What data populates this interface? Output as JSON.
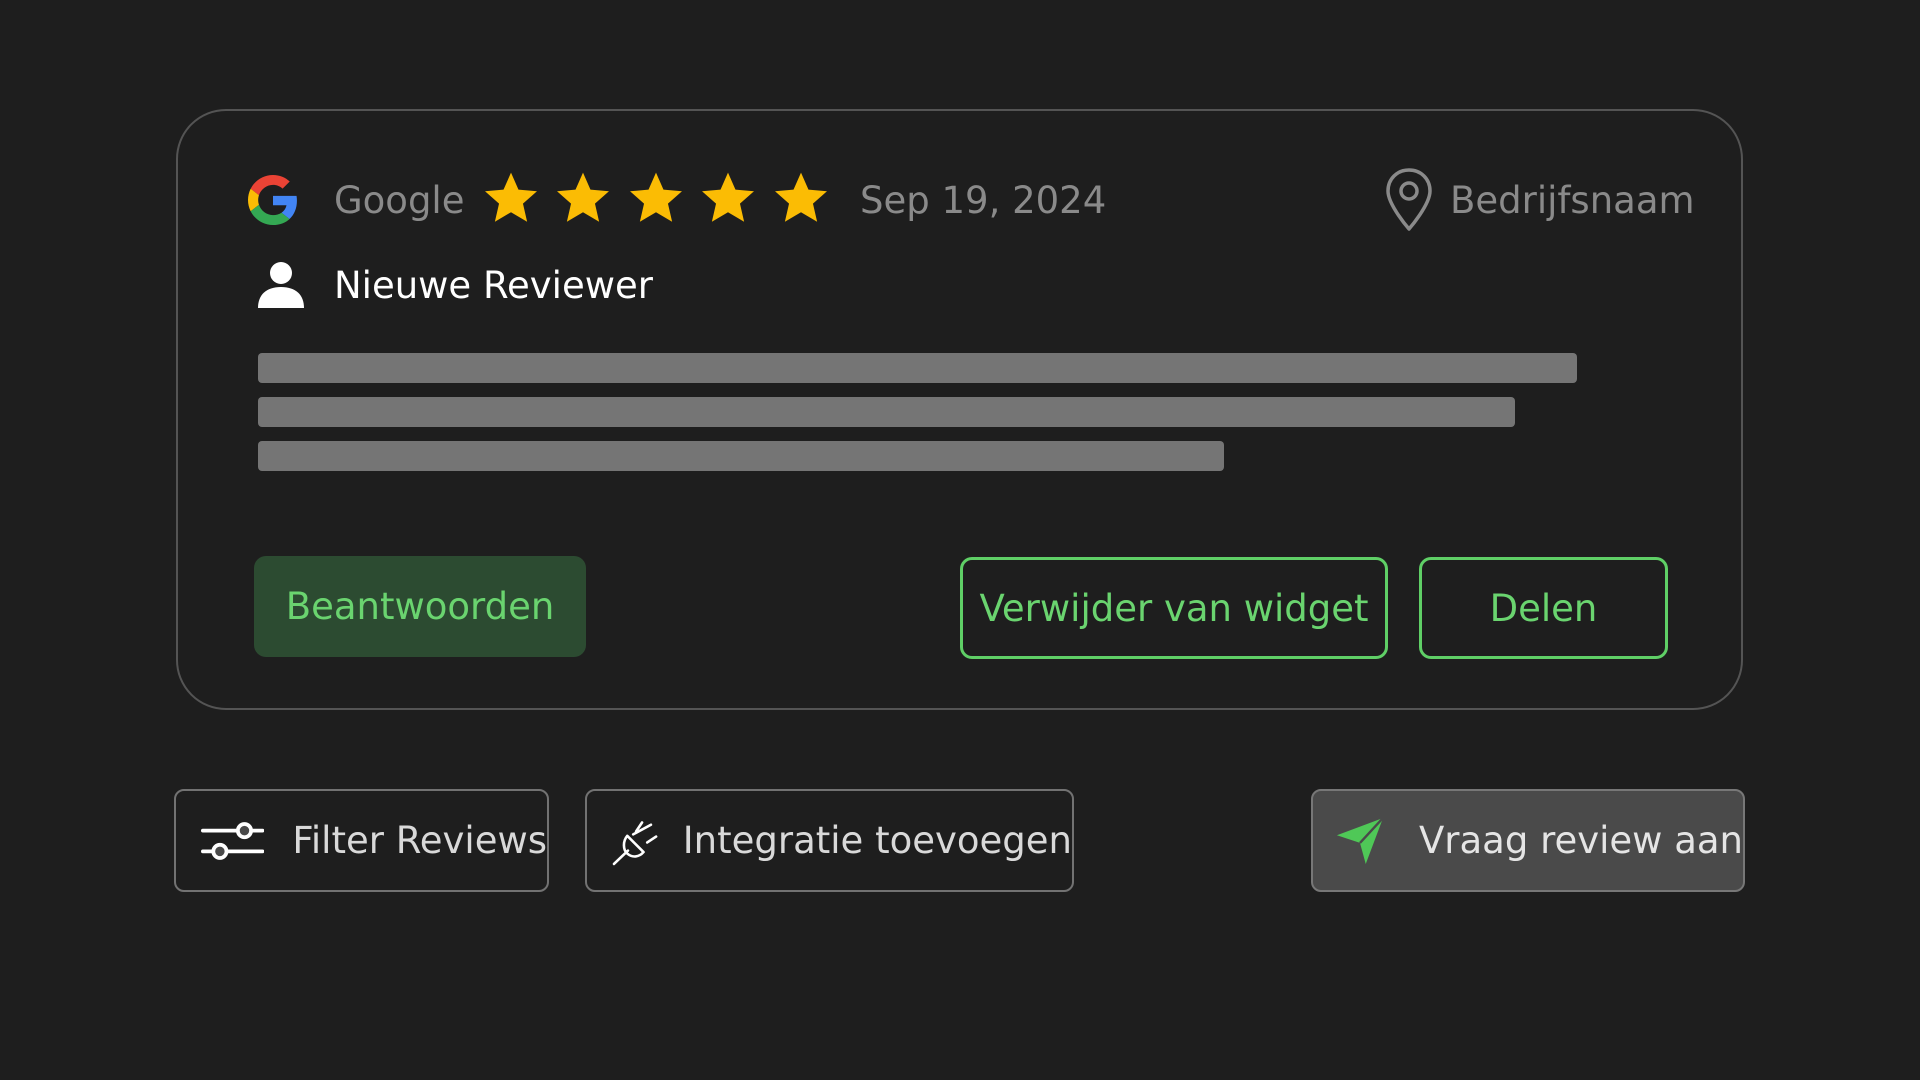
{
  "review": {
    "source": "Google",
    "rating": 5,
    "rating_max": 5,
    "date": "Sep 19, 2024",
    "location": "Bedrijfsnaam",
    "reviewer": "Nieuwe Reviewer",
    "text_placeholder_lines": 3
  },
  "buttons": {
    "reply": "Beantwoorden",
    "remove": "Verwijder van widget",
    "share": "Delen"
  },
  "actions": {
    "filter": "Filter Reviews",
    "integration": "Integratie toevoegen",
    "request": "Vraag review aan"
  },
  "icons": {
    "source": "google-logo",
    "rating": "star-icon",
    "location": "map-pin-icon",
    "reviewer": "user-icon",
    "filter": "sliders-icon",
    "integration": "plug-icon",
    "request": "paper-plane-icon"
  },
  "colors": {
    "background": "#1e1e1e",
    "star": "#fbbc04",
    "accent_green": "#6ad46f",
    "reply_button_bg": "#2c4b31",
    "text_placeholder": "#757575"
  }
}
